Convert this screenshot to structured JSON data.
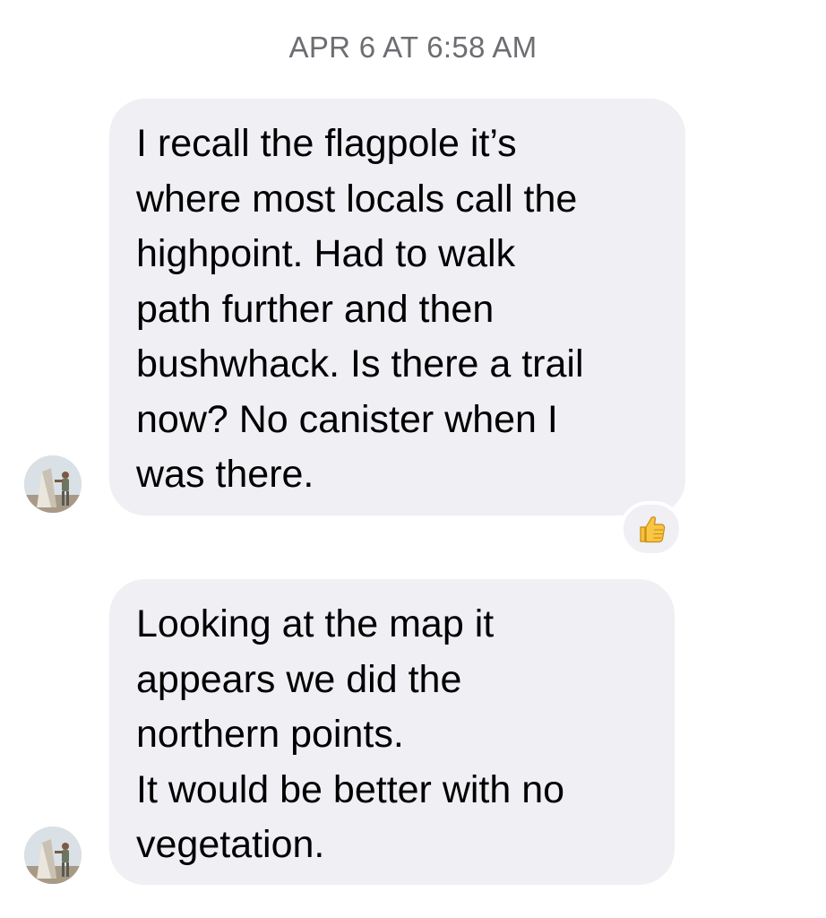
{
  "conversation": {
    "timestamp": "APR 6 AT 6:58 AM",
    "messages": [
      {
        "text": "I recall the flagpole it’s\nwhere most locals call the\nhighpoint. Had to walk\npath further and then\nbushwhack. Is there a trail\nnow? No canister when I\nwas there.",
        "avatar_icon": "person-at-monument-avatar",
        "reaction_icon": "thumbs-up-icon"
      },
      {
        "text": "Looking at the map it\nappears we did the\nnorthern points.\nIt would be better with no\nvegetation.",
        "avatar_icon": "person-at-monument-avatar"
      }
    ]
  },
  "colors": {
    "bubble_background": "#efeff4",
    "timestamp_text": "#6d6d72",
    "message_text": "#000000",
    "reaction_emoji": "#f6c23e"
  }
}
